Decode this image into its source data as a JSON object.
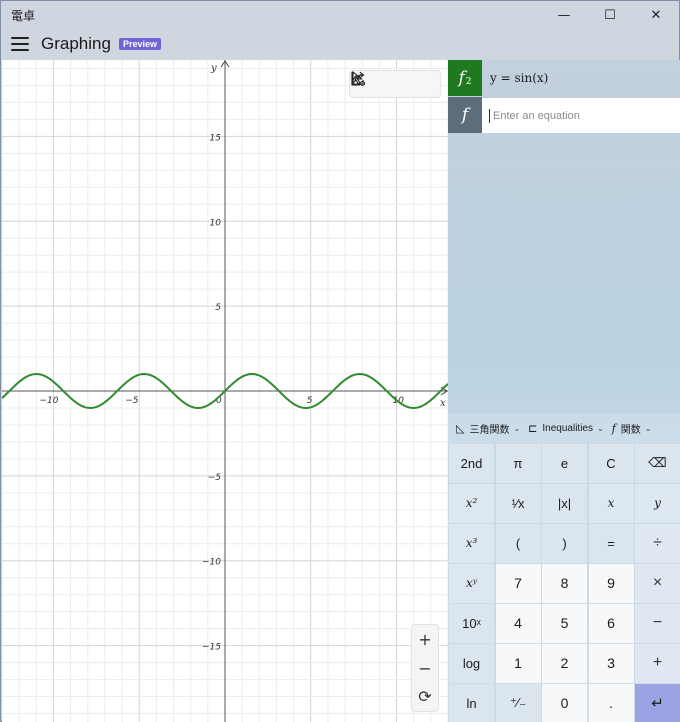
{
  "window": {
    "app_title": "電卓",
    "controls": {
      "minimize": "—",
      "maximize": "☐",
      "close": "✕"
    }
  },
  "header": {
    "title": "Graphing",
    "badge": "Preview"
  },
  "graph": {
    "x_range": [
      -13,
      13
    ],
    "y_range": [
      -19.5,
      19.5
    ],
    "x_axis_label": "x",
    "y_axis_label": "y",
    "x_tick_labels": [
      "−10",
      "−5",
      "0",
      "5",
      "10"
    ],
    "x_tick_values": [
      -10,
      -5,
      0,
      5,
      10
    ],
    "y_tick_labels": [
      "15",
      "10",
      "5",
      "−5",
      "−10",
      "−15"
    ],
    "y_tick_values": [
      15,
      10,
      5,
      -5,
      -10,
      -15
    ],
    "curve_color": "#2e8b2e",
    "grid": true,
    "tools": [
      "select-icon",
      "share-icon",
      "graph-settings-icon"
    ],
    "zoom": {
      "in": "+",
      "out": "−",
      "reset": "⟳"
    }
  },
  "chart_data": {
    "type": "line",
    "series": [
      {
        "name": "y = sin(x)",
        "function": "sin(x)",
        "color": "#2e8b2e"
      }
    ],
    "xlim": [
      -13,
      13
    ],
    "ylim": [
      -19.5,
      19.5
    ],
    "xlabel": "x",
    "ylabel": "y"
  },
  "equations": [
    {
      "badge": "f",
      "badge_sub": "2",
      "expression": "y = sin(x)",
      "color": "#1f7a1f"
    }
  ],
  "new_equation": {
    "badge": "f",
    "placeholder": "Enter an equation",
    "color": "#5e6d7c"
  },
  "keypad_toolbar": {
    "trig": "三角関数",
    "inequalities": "Inequalities",
    "functions": "関数"
  },
  "keypad": [
    [
      "2nd",
      "π",
      "e",
      "C",
      "⌫"
    ],
    [
      "x²",
      "¹⁄x",
      "|x|",
      "x",
      "y"
    ],
    [
      "x³",
      "(",
      ")",
      "=",
      "÷"
    ],
    [
      "xʸ",
      "7",
      "8",
      "9",
      "×"
    ],
    [
      "10ˣ",
      "4",
      "5",
      "6",
      "−"
    ],
    [
      "log",
      "1",
      "2",
      "3",
      "+"
    ],
    [
      "ln",
      "⁺∕₋",
      "0",
      ".",
      "↵"
    ]
  ]
}
